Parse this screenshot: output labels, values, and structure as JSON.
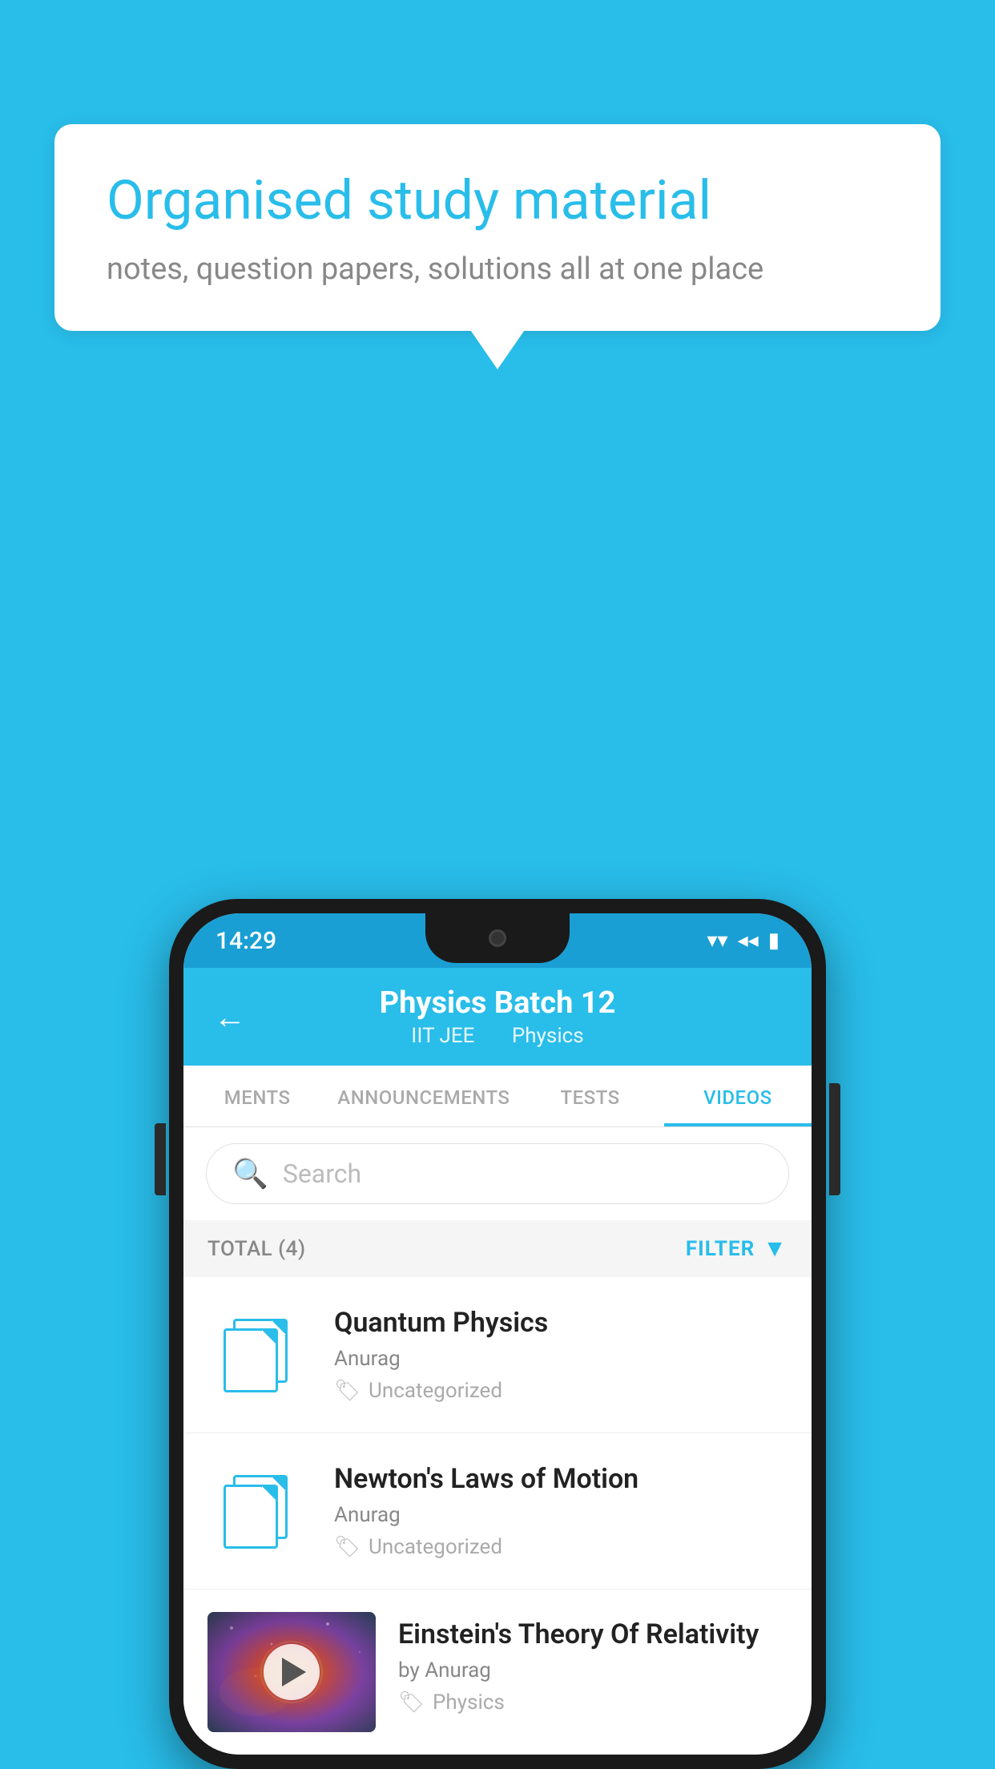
{
  "background_color": "#29BDEA",
  "speech_bubble": {
    "title": "Organised study material",
    "subtitle": "notes, question papers, solutions all at one place"
  },
  "status_bar": {
    "time": "14:29",
    "wifi_icon": "▾",
    "signal_icon": "◂",
    "battery_icon": "▮"
  },
  "app_header": {
    "back_label": "←",
    "title": "Physics Batch 12",
    "subtitle_part1": "IIT JEE",
    "subtitle_part2": "Physics"
  },
  "tabs": [
    {
      "label": "MENTS",
      "active": false
    },
    {
      "label": "ANNOUNCEMENTS",
      "active": false
    },
    {
      "label": "TESTS",
      "active": false
    },
    {
      "label": "VIDEOS",
      "active": true
    }
  ],
  "search": {
    "placeholder": "Search"
  },
  "filter_bar": {
    "total_label": "TOTAL (4)",
    "filter_label": "FILTER"
  },
  "videos": [
    {
      "title": "Quantum Physics",
      "author": "Anurag",
      "tag": "Uncategorized",
      "type": "file"
    },
    {
      "title": "Newton's Laws of Motion",
      "author": "Anurag",
      "tag": "Uncategorized",
      "type": "file"
    },
    {
      "title": "Einstein's Theory Of Relativity",
      "author": "by Anurag",
      "tag": "Physics",
      "type": "video"
    }
  ]
}
